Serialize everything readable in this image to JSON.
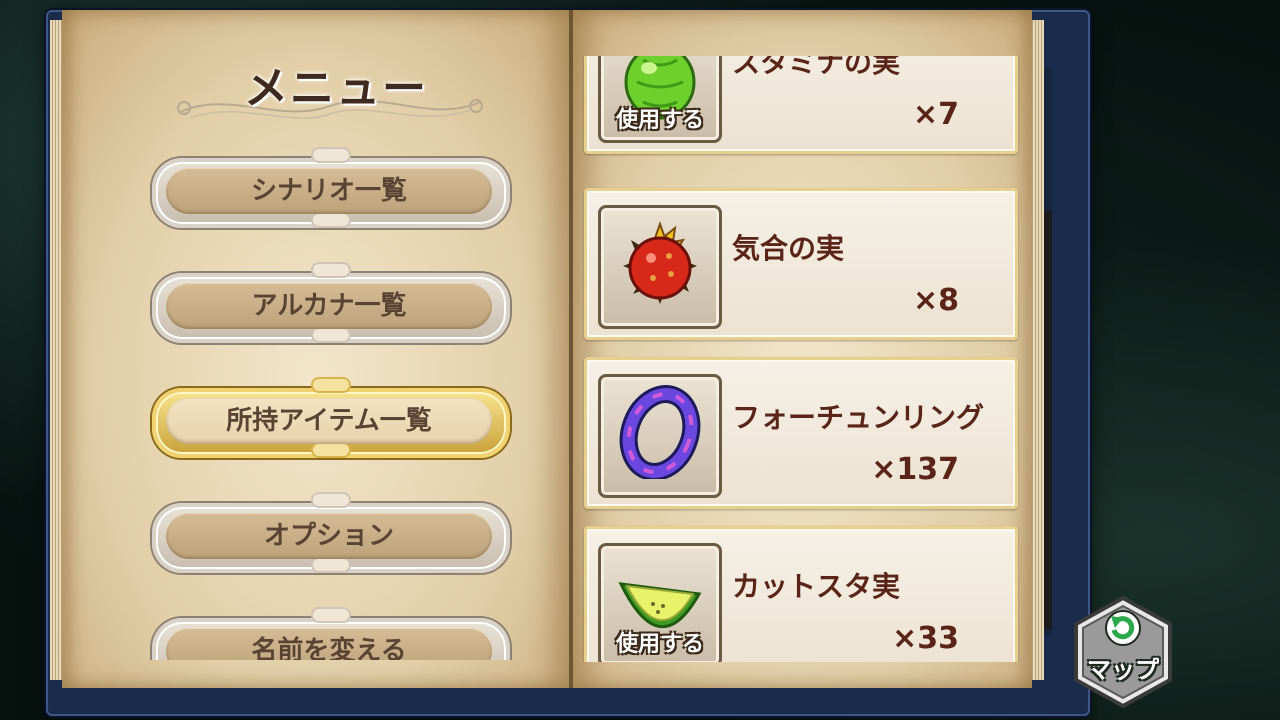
{
  "menu": {
    "title": "メニュー",
    "items": [
      {
        "label": "シナリオ一覧",
        "active": false
      },
      {
        "label": "アルカナ一覧",
        "active": false
      },
      {
        "label": "所持アイテム一覧",
        "active": true
      },
      {
        "label": "オプション",
        "active": false
      },
      {
        "label": "名前を変える",
        "active": false
      }
    ]
  },
  "items": [
    {
      "name": "スタミナの実",
      "count": "×7",
      "icon": "green-fruit-icon",
      "use_label": "使用する"
    },
    {
      "name": "気合の実",
      "count": "×8",
      "icon": "red-spiky-fruit-icon",
      "use_label": ""
    },
    {
      "name": "フォーチュンリング",
      "count": "×137",
      "icon": "ring-icon",
      "use_label": ""
    },
    {
      "name": "カットスタ実",
      "count": "×33",
      "icon": "cut-fruit-icon",
      "use_label": "使用する"
    }
  ],
  "map_button": {
    "label": "マップ",
    "icon": "refresh-arrow-icon"
  },
  "colors": {
    "book_cover": "#1a2c4c",
    "item_text": "#5a2418",
    "menu_text": "#5b4334",
    "active_gold": "#f0d270"
  }
}
